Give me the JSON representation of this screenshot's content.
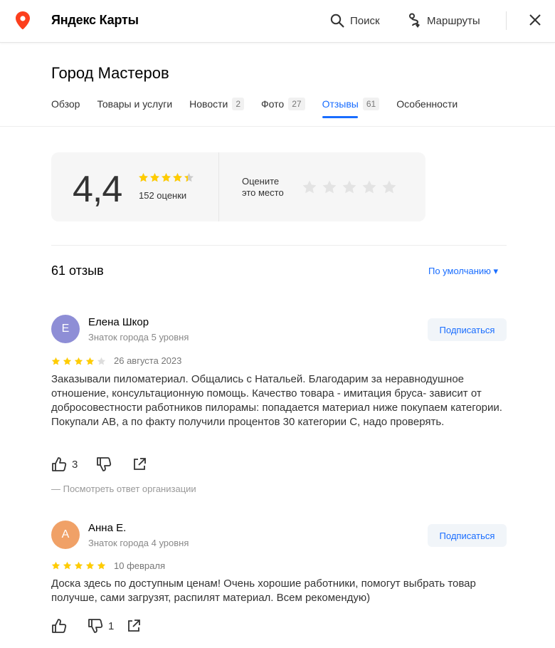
{
  "header": {
    "app_title": "Яндекс Карты",
    "search_label": "Поиск",
    "routes_label": "Маршруты"
  },
  "org": {
    "title": "Город Мастеров"
  },
  "tabs": [
    {
      "label": "Обзор",
      "count": ""
    },
    {
      "label": "Товары и услуги",
      "count": ""
    },
    {
      "label": "Новости",
      "count": "2"
    },
    {
      "label": "Фото",
      "count": "27"
    },
    {
      "label": "Отзывы",
      "count": "61",
      "active": true
    },
    {
      "label": "Особенности",
      "count": ""
    }
  ],
  "rating": {
    "score": "4,4",
    "score_value": 4.4,
    "count_label": "152 оценки",
    "rate_prompt_line1": "Оцените",
    "rate_prompt_line2": "это место"
  },
  "reviews_header": {
    "count_label": "61 отзыв",
    "sort_label": "По умолчанию ▾"
  },
  "reviews": [
    {
      "avatar_letter": "Е",
      "avatar_color": "#8e8ed6",
      "author": "Елена Шкор",
      "level": "Знаток города 5 уровня",
      "subscribe_label": "Подписаться",
      "stars": 4,
      "date": "26 августа 2023",
      "text": "Заказывали пиломатериал. Общались с Натальей. Благодарим за неравнодушное отношение, консультационную помощь. Качество товара - имитация бруса- зависит от добросовестности работников пилорамы: попадается материал ниже покупаем категории. Покупали АВ, а по факту получили процентов 30 категории С, надо проверять.",
      "likes": "3",
      "dislikes": "",
      "org_answer_label": "— Посмотреть ответ организации"
    },
    {
      "avatar_letter": "А",
      "avatar_color": "#f0a167",
      "author": "Анна Е.",
      "level": "Знаток города 4 уровня",
      "subscribe_label": "Подписаться",
      "stars": 5,
      "date": "10 февраля",
      "text": "Доска здесь по доступным ценам! Очень хорошие работники, помогут выбрать товар получше, сами загрузят, распилят материал. Всем рекомендую)",
      "likes": "",
      "dislikes": "1"
    }
  ],
  "colors": {
    "accent": "#196dff",
    "star_gold": "#fc0",
    "star_empty": "#e0e0e0",
    "logo_red": "#fc3f1d"
  },
  "icons": [
    "map-pin-logo-icon",
    "search-icon",
    "routes-icon",
    "close-icon",
    "star-icon",
    "thumb-up-icon",
    "thumb-down-icon",
    "share-icon"
  ]
}
